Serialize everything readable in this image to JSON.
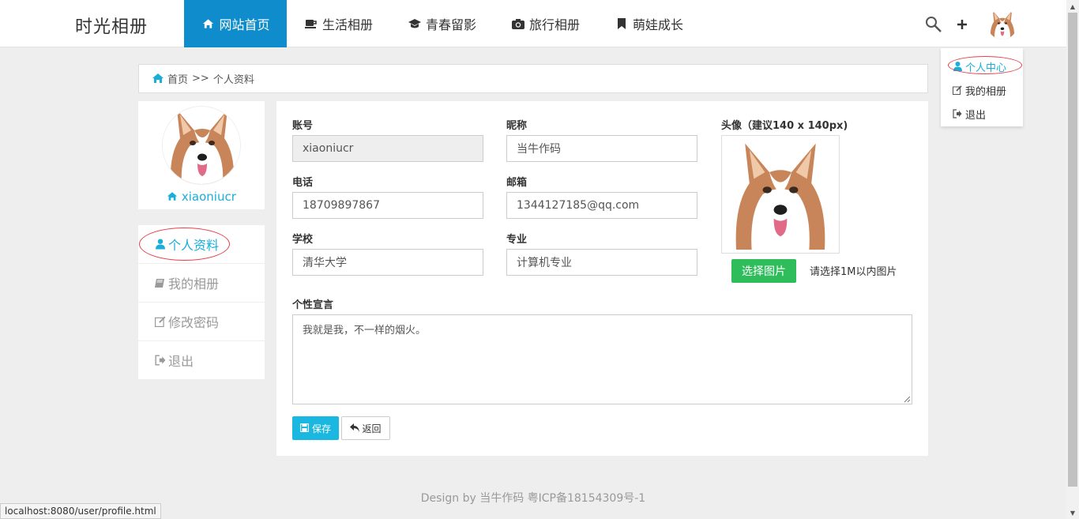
{
  "brand": "时光相册",
  "nav": [
    {
      "label": "网站首页",
      "icon": "home-icon",
      "active": true
    },
    {
      "label": "生活相册",
      "icon": "coffee-icon"
    },
    {
      "label": "青春留影",
      "icon": "graduation-cap-icon"
    },
    {
      "label": "旅行相册",
      "icon": "camera-icon"
    },
    {
      "label": "萌娃成长",
      "icon": "bookmark-icon"
    }
  ],
  "dropdown": {
    "items": [
      {
        "label": "个人中心",
        "icon": "user-icon"
      },
      {
        "label": "我的相册",
        "icon": "edit-icon"
      },
      {
        "label": "退出",
        "icon": "sign-out-icon"
      }
    ]
  },
  "breadcrumb": {
    "home": "首页",
    "separator": ">>",
    "current": "个人资料"
  },
  "profile": {
    "username": "xiaoniucr"
  },
  "side_menu": [
    {
      "label": "个人资料",
      "icon": "user-icon"
    },
    {
      "label": "我的相册",
      "icon": "book-icon"
    },
    {
      "label": "修改密码",
      "icon": "edit-icon"
    },
    {
      "label": "退出",
      "icon": "sign-out-icon"
    }
  ],
  "form": {
    "account_label": "账号",
    "account_value": "xiaoniucr",
    "nickname_label": "昵称",
    "nickname_value": "当牛作码",
    "phone_label": "电话",
    "phone_value": "18709897867",
    "email_label": "邮箱",
    "email_value": "1344127185@qq.com",
    "school_label": "学校",
    "school_value": "清华大学",
    "major_label": "专业",
    "major_value": "计算机专业",
    "avatar_label": "头像（建议140 x 140px)",
    "upload_button": "选择图片",
    "upload_hint": "请选择1M以内图片",
    "motto_label": "个性宣言",
    "motto_value": "我就是我，不一样的烟火。",
    "save_button": "保存",
    "back_button": "返回"
  },
  "footer": "Design by 当牛作码 粤ICP备18154309号-1",
  "status_url": "localhost:8080/user/profile.html",
  "colors": {
    "accent": "#0e8ccc",
    "link": "#1aaed9",
    "upload": "#2ebd5a",
    "save": "#1ab8e0",
    "highlight_ring": "#e8404a"
  }
}
